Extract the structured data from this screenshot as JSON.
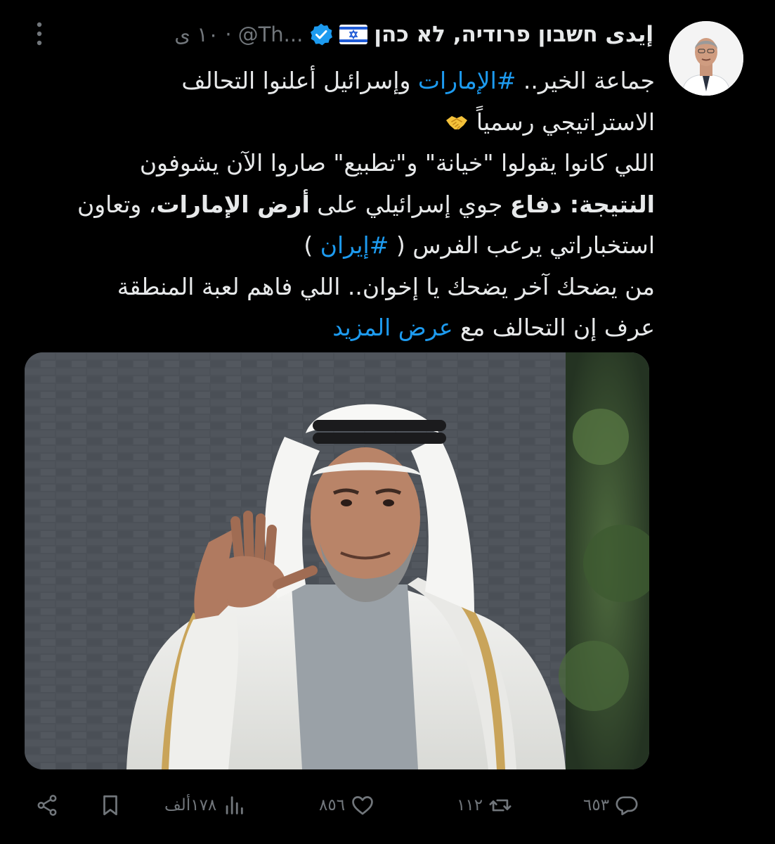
{
  "tweet": {
    "display_name": "إيدى חשבון פרודיה, לא כהן",
    "flag": "🇮🇱",
    "handle": "@Th...",
    "time": "١٠ ى",
    "lines": [
      [
        {
          "t": "جماعة الخير.. "
        },
        {
          "t": "#الإمارات",
          "k": "hashtag"
        },
        {
          "t": " وإسرائيل أعلنوا التحالف"
        }
      ],
      [
        {
          "t": "الاستراتيجي رسمياً "
        },
        {
          "t": "handshake",
          "k": "emoji"
        }
      ],
      [
        {
          "t": "اللي كانوا يقولوا \"خيانة\" و\"تطبيع\" صاروا الآن يشوفون"
        }
      ],
      [
        {
          "t": "النتيجة: دفاع",
          "k": "bold"
        },
        {
          "t": " جوي إسرائيلي على "
        },
        {
          "t": "أرض الإمارات",
          "k": "bold"
        },
        {
          "t": "، وتعاون"
        }
      ],
      [
        {
          "t": "استخباراتي يرعب الفرس ( "
        },
        {
          "t": "#إيران",
          "k": "hashtag"
        },
        {
          "t": " )"
        }
      ],
      [
        {
          "t": "من يضحك آخر يضحك يا إخوان.. اللي فاهم لعبة المنطقة"
        }
      ],
      [
        {
          "t": "عرف إن التحالف مع "
        },
        {
          "t": "عرض المزيد",
          "k": "show-more"
        }
      ]
    ]
  },
  "actions": {
    "replies": "٦٥٣",
    "reposts": "١١٢",
    "likes": "٨٥٦",
    "views": "١٧٨ألف"
  },
  "icons": {
    "menu": "more-icon",
    "verified": "verified-badge-icon",
    "reply": "reply-icon",
    "repost": "repost-icon",
    "like": "like-icon",
    "views": "views-icon",
    "bookmark": "bookmark-icon",
    "share": "share-icon"
  },
  "colors": {
    "background": "#000000",
    "text": "#e7e9ea",
    "muted": "#71767b",
    "accent": "#1d9bf0"
  }
}
